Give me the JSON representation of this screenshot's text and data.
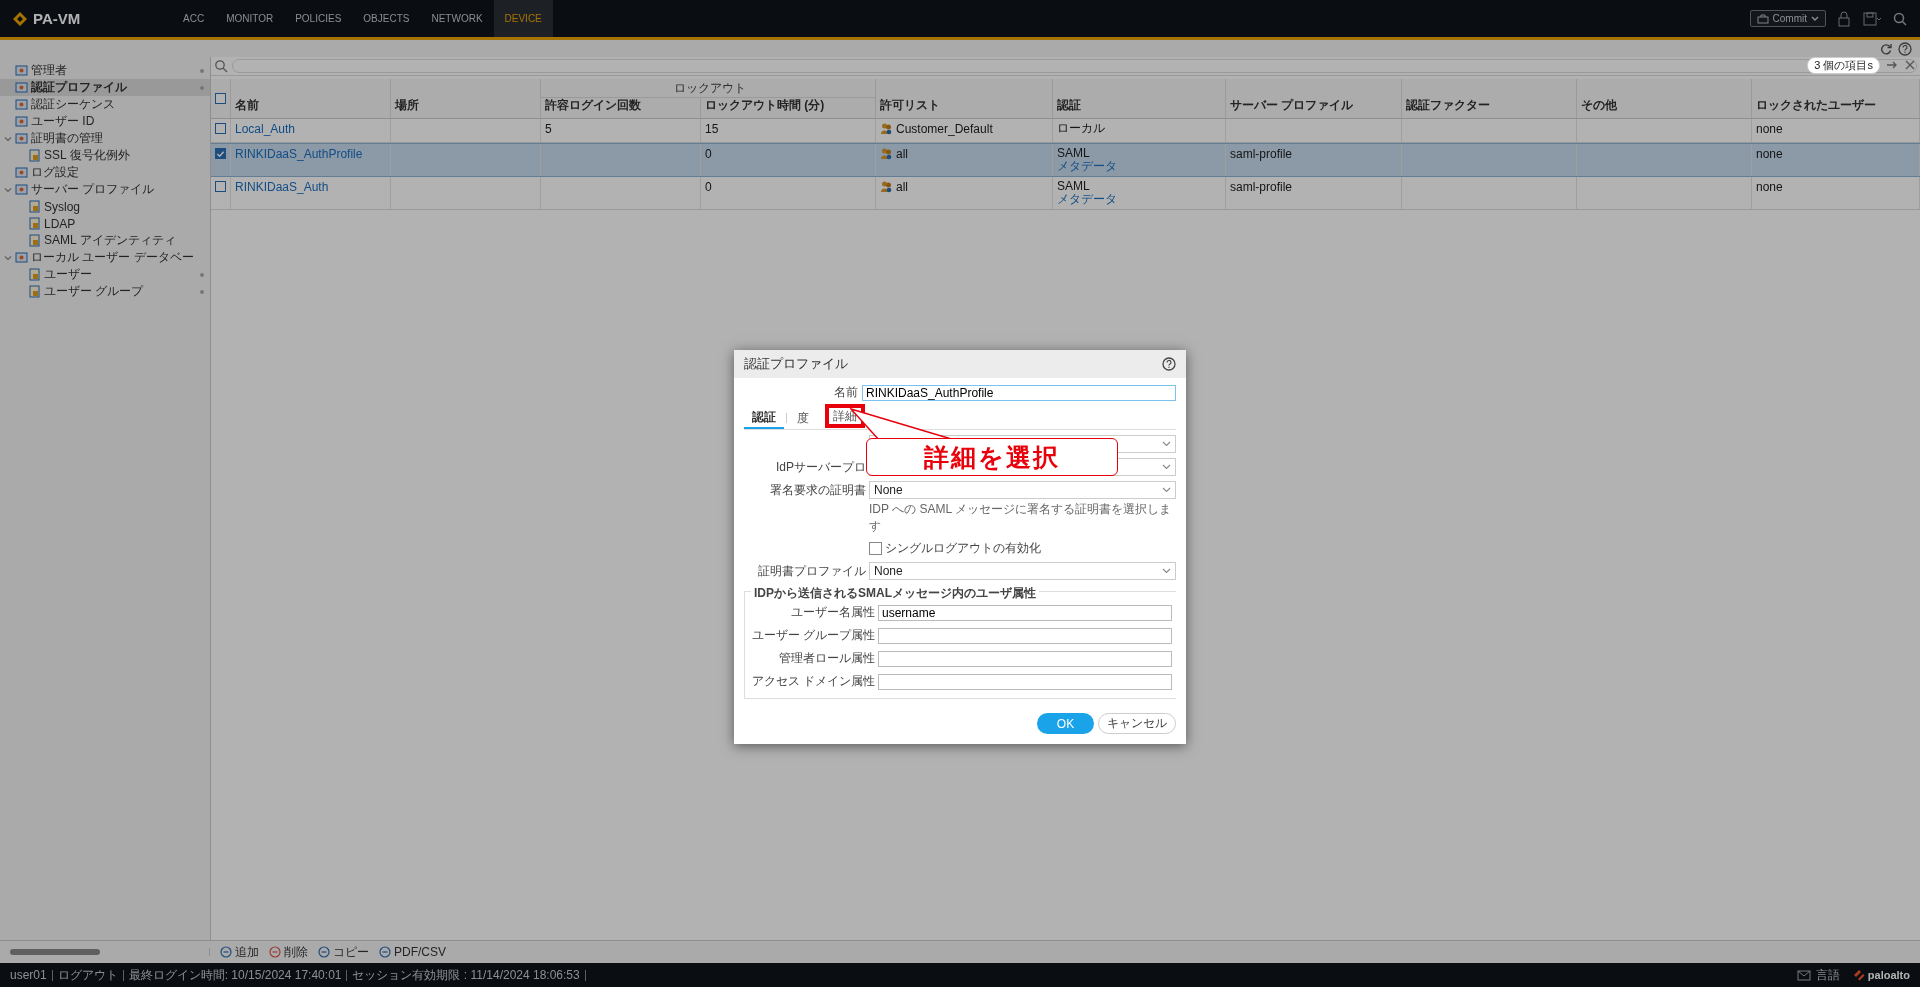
{
  "app": {
    "brand": "PA-VM",
    "commit_label": "Commit",
    "nav": [
      {
        "label": "ACC",
        "selected": false
      },
      {
        "label": "MONITOR",
        "selected": false
      },
      {
        "label": "POLICIES",
        "selected": false
      },
      {
        "label": "OBJECTS",
        "selected": false
      },
      {
        "label": "NETWORK",
        "selected": false
      },
      {
        "label": "DEVICE",
        "selected": true
      }
    ]
  },
  "sidebar": {
    "items": [
      {
        "label": "管理者",
        "selected": false,
        "dot": true
      },
      {
        "label": "認証プロファイル",
        "selected": true,
        "dot": true
      },
      {
        "label": "認証シーケンス",
        "selected": false,
        "dot": false
      },
      {
        "label": "ユーザー ID",
        "selected": false,
        "dot": false
      },
      {
        "label": "証明書の管理",
        "selected": false,
        "dot": false,
        "expanded": true,
        "children": [
          {
            "label": "SSL 復号化例外",
            "selected": false,
            "dot": false
          }
        ]
      },
      {
        "label": "ログ設定",
        "selected": false,
        "dot": false
      },
      {
        "label": "サーバー プロファイル",
        "selected": false,
        "dot": false,
        "expanded": true,
        "children": [
          {
            "label": "Syslog",
            "selected": false,
            "dot": false
          },
          {
            "label": "LDAP",
            "selected": false,
            "dot": false
          },
          {
            "label": "SAML アイデンティティ",
            "selected": false,
            "dot": false
          }
        ]
      },
      {
        "label": "ローカル ユーザー データベー",
        "selected": false,
        "dot": false,
        "expanded": true,
        "children": [
          {
            "label": "ユーザー",
            "selected": false,
            "dot": true
          },
          {
            "label": "ユーザー グループ",
            "selected": false,
            "dot": true
          }
        ]
      }
    ]
  },
  "table": {
    "count": "3 個の項目s",
    "select_all_checked": false,
    "lockout_group": "ロックアウト",
    "columns": [
      "名前",
      "場所",
      "許容ログイン回数",
      "ロックアウト時間 (分)",
      "許可リスト",
      "認証",
      "サーバー プロファイル",
      "認証ファクター",
      "その他",
      "ロックされたユーザー"
    ],
    "rows": [
      {
        "checked": false,
        "name": "Local_Auth",
        "attempts": "5",
        "lockout_time": "15",
        "allow_list": "Customer_Default",
        "auth_method": "ローカル",
        "locked_users": "none"
      },
      {
        "checked": true,
        "name": "RINKIDaaS_AuthProfile",
        "lockout_time": "0",
        "allow_list": "all",
        "auth_method": "SAML",
        "auth_link": "メタデータ",
        "server_profile": "saml-profile",
        "locked_users": "none"
      },
      {
        "checked": false,
        "name": "RINKIDaaS_Auth",
        "lockout_time": "0",
        "allow_list": "all",
        "auth_method": "SAML",
        "auth_link": "メタデータ",
        "server_profile": "saml-profile",
        "locked_users": "none"
      }
    ]
  },
  "actions": [
    "追加",
    "削除",
    "コピー",
    "PDF/CSV"
  ],
  "status_bar": {
    "user": "user01",
    "logout": "ログアウト",
    "last_login": "最終ログイン時間: 10/15/2024 17:40:01",
    "session": "セッション有効期限 : 11/14/2024 18:06:53",
    "language": "言語",
    "vendor": "paloalto"
  },
  "dialog": {
    "title": "認証プロファイル",
    "name_label": "名前",
    "name_value": "RINKIDaaS_AuthProfile",
    "tabs": [
      {
        "label": "認証",
        "selected": true,
        "highlighted": false
      },
      {
        "label": "度",
        "selected": false,
        "highlighted": false
      },
      {
        "label": "詳細",
        "selected": false,
        "highlighted": true
      }
    ],
    "fields": [
      {
        "kind": "select"
      },
      {
        "kind": "select",
        "label": "IdPサーバープロ"
      },
      {
        "kind": "select",
        "label": "署名要求の証明書",
        "value": "None"
      },
      {
        "kind": "hint",
        "text": "IDP への SAML メッセージに署名する証明書を選択します"
      },
      {
        "kind": "checkbox",
        "label": "シングルログアウトの有効化",
        "checked": false
      },
      {
        "kind": "select",
        "label": "証明書プロファイル",
        "value": "None"
      }
    ],
    "attributes": {
      "legend": "IDPから送信されるSMALメッセージ内のユーザ属性",
      "fields": [
        {
          "label": "ユーザー名属性",
          "value": "username"
        },
        {
          "label": "ユーザー グループ属性"
        },
        {
          "label": "管理者ロール属性"
        },
        {
          "label": "アクセス ドメイン属性"
        }
      ]
    },
    "ok": "OK",
    "cancel": "キャンセル"
  },
  "annotation": {
    "text": "詳細を選択"
  }
}
